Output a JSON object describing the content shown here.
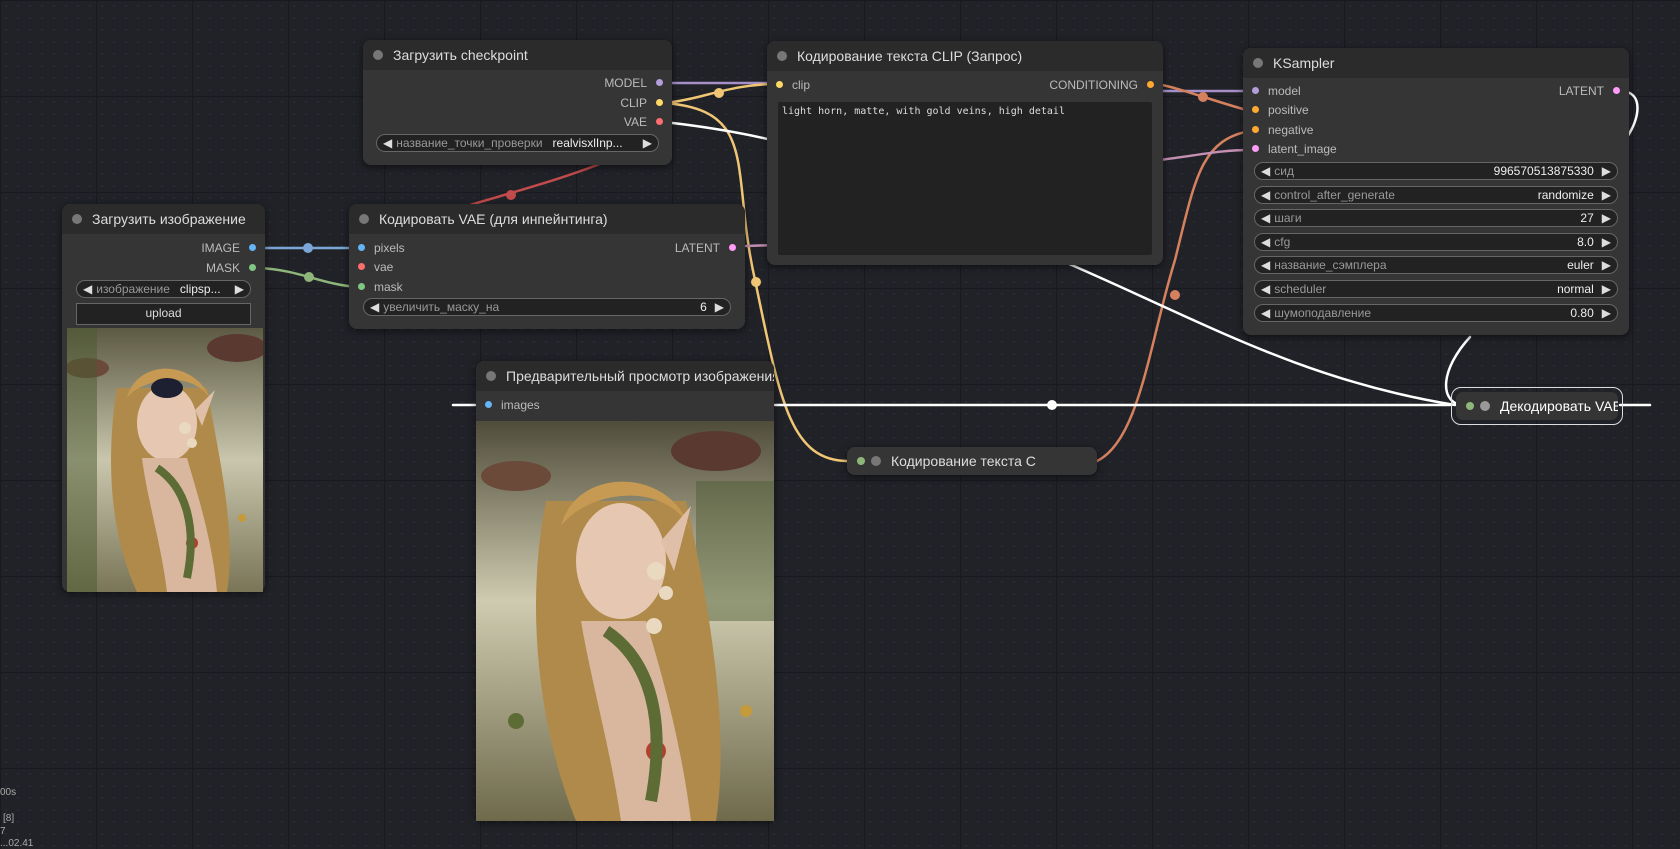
{
  "colors": {
    "model": "#b39ddb",
    "clip": "#ffd866",
    "vae": "#ff6e6e",
    "latent": "#ff9cf9",
    "image": "#64b5f6",
    "mask": "#81c784",
    "conditioning": "#ffa931",
    "wire_white": "#ffffff",
    "wire_orange": "#d6815e",
    "wire_yellow": "#f0c674",
    "wire_purple": "#a68fc9",
    "wire_red": "#c24b4b",
    "wire_green": "#8fb67a",
    "wire_blue": "#7ba7d6",
    "wire_pink": "#c48fb2"
  },
  "nodes": {
    "checkpoint": {
      "title": "Загрузить checkpoint",
      "outputs": [
        "MODEL",
        "CLIP",
        "VAE"
      ],
      "widget": {
        "label": "название_точки_проверки",
        "value": "realvisxlInp..."
      }
    },
    "clip_prompt": {
      "title": "Кодирование текста CLIP (Запрос)",
      "input": "clip",
      "output": "CONDITIONING",
      "text": "light horn, matte, with gold veins, high detail"
    },
    "ksampler": {
      "title": "KSampler",
      "inputs": [
        "model",
        "positive",
        "negative",
        "latent_image"
      ],
      "output": "LATENT",
      "widgets": [
        {
          "label": "сид",
          "value": "996570513875330"
        },
        {
          "label": "control_after_generate",
          "value": "randomize"
        },
        {
          "label": "шаги",
          "value": "27"
        },
        {
          "label": "cfg",
          "value": "8.0"
        },
        {
          "label": "название_сэмплера",
          "value": "euler"
        },
        {
          "label": "scheduler",
          "value": "normal"
        },
        {
          "label": "шумоподавление",
          "value": "0.80"
        }
      ]
    },
    "load_image": {
      "title": "Загрузить изображение",
      "outputs": [
        "IMAGE",
        "MASK"
      ],
      "widget": {
        "label": "изображение",
        "value": "clipsp..."
      },
      "upload_label": "upload"
    },
    "vae_encode": {
      "title": "Кодировать VAE (для инпейнтинга)",
      "inputs": [
        "pixels",
        "vae",
        "mask"
      ],
      "output": "LATENT",
      "widget": {
        "label": "увеличить_маску_на",
        "value": "6"
      }
    },
    "preview": {
      "title": "Предварительный просмотр изображения",
      "input": "images"
    },
    "clip_collapsed": {
      "title": "Кодирование текста C"
    },
    "vae_decode": {
      "title": "Декодировать VAE"
    }
  },
  "stats": [
    "00s",
    "[8]",
    "7",
    "...02.41"
  ]
}
